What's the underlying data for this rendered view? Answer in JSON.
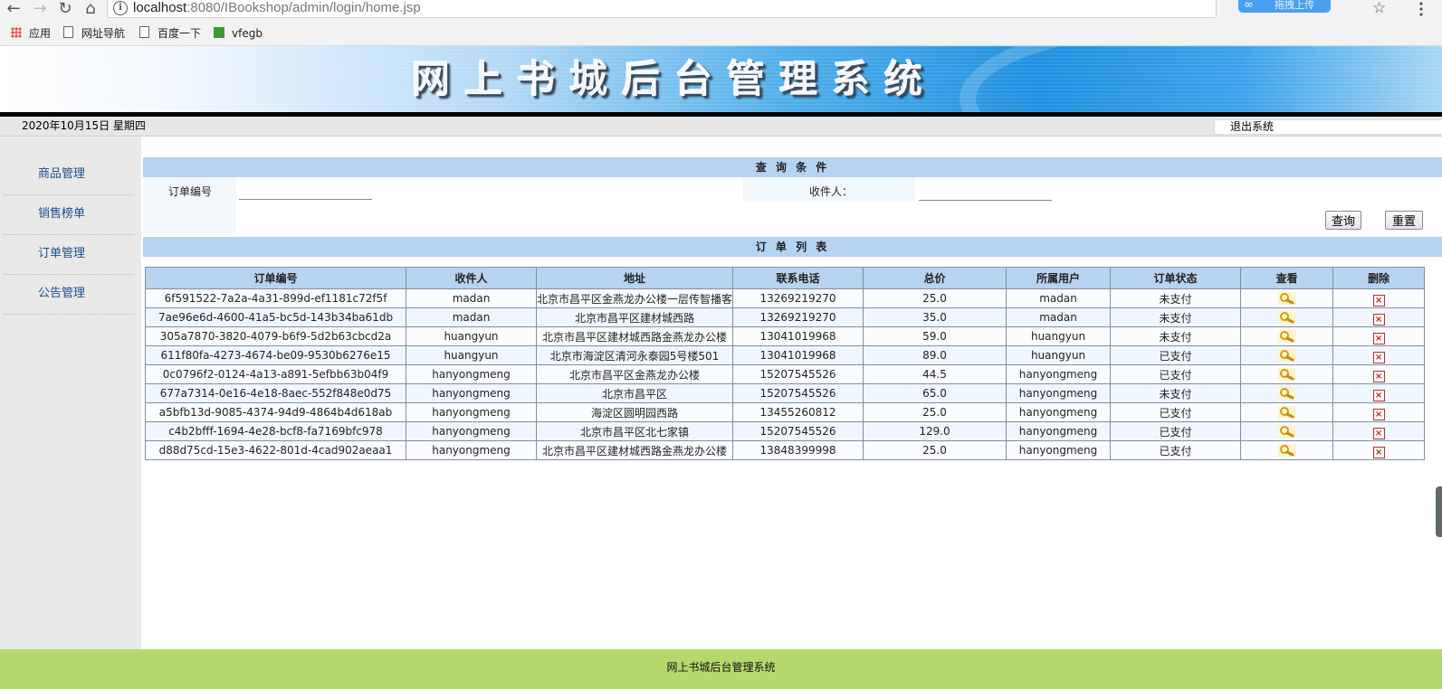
{
  "browser": {
    "url_host": "localhost",
    "url_port": ":8080",
    "url_path": "/IBookshop/admin/login/home.jsp",
    "ext_button": "拖拽上传",
    "bookmarks": [
      "应用",
      "网址导航",
      "百度一下",
      "vfegb"
    ]
  },
  "header": {
    "title": "网上书城后台管理系统",
    "date": "2020年10月15日 星期四",
    "logout": "退出系统"
  },
  "sidebar": {
    "items": [
      {
        "label": "商品管理"
      },
      {
        "label": "销售榜单"
      },
      {
        "label": "订单管理"
      },
      {
        "label": "公告管理"
      }
    ]
  },
  "query": {
    "heading": "查 询 条 件",
    "order_id_label": "订单编号",
    "order_id_value": "",
    "receiver_label": "收件人：",
    "receiver_value": "",
    "search_button": "查询",
    "reset_button": "重置"
  },
  "orders": {
    "heading": "订 单 列 表",
    "columns": [
      "订单编号",
      "收件人",
      "地址",
      "联系电话",
      "总价",
      "所属用户",
      "订单状态",
      "查看",
      "删除"
    ],
    "rows": [
      [
        "6f591522-7a2a-4a31-899d-ef1181c72f5f",
        "madan",
        "北京市昌平区金燕龙办公楼一层传智播客",
        "13269219270",
        "25.0",
        "madan",
        "未支付"
      ],
      [
        "7ae96e6d-4600-41a5-bc5d-143b34ba61db",
        "madan",
        "北京市昌平区建材城西路",
        "13269219270",
        "35.0",
        "madan",
        "未支付"
      ],
      [
        "305a7870-3820-4079-b6f9-5d2b63cbcd2a",
        "huangyun",
        "北京市昌平区建材城西路金燕龙办公楼",
        "13041019968",
        "59.0",
        "huangyun",
        "未支付"
      ],
      [
        "611f80fa-4273-4674-be09-9530b6276e15",
        "huangyun",
        "北京市海淀区清河永泰园5号楼501",
        "13041019968",
        "89.0",
        "huangyun",
        "已支付"
      ],
      [
        "0c0796f2-0124-4a13-a891-5efbb63b04f9",
        "hanyongmeng",
        "北京市昌平区金燕龙办公楼",
        "15207545526",
        "44.5",
        "hanyongmeng",
        "已支付"
      ],
      [
        "677a7314-0e16-4e18-8aec-552f848e0d75",
        "hanyongmeng",
        "北京市昌平区",
        "15207545526",
        "65.0",
        "hanyongmeng",
        "未支付"
      ],
      [
        "a5bfb13d-9085-4374-94d9-4864b4d618ab",
        "hanyongmeng",
        "海淀区圆明园西路",
        "13455260812",
        "25.0",
        "hanyongmeng",
        "已支付"
      ],
      [
        "c4b2bfff-1694-4e28-bcf8-fa7169bfc978",
        "hanyongmeng",
        "北京市昌平区北七家镇",
        "15207545526",
        "129.0",
        "hanyongmeng",
        "已支付"
      ],
      [
        "d88d75cd-15e3-4622-801d-4cad902aeaa1",
        "hanyongmeng",
        "北京市昌平区建材城西路金燕龙办公楼",
        "13848399998",
        "25.0",
        "hanyongmeng",
        "已支付"
      ]
    ],
    "view_icon": "magnifier-icon",
    "delete_icon": "delete-x-icon"
  },
  "footer": {
    "text": "网上书城后台管理系统"
  },
  "colors": {
    "band": "#b6d3ef",
    "footer": "#b5d86d",
    "sidebar_link": "#1e4e8c"
  }
}
